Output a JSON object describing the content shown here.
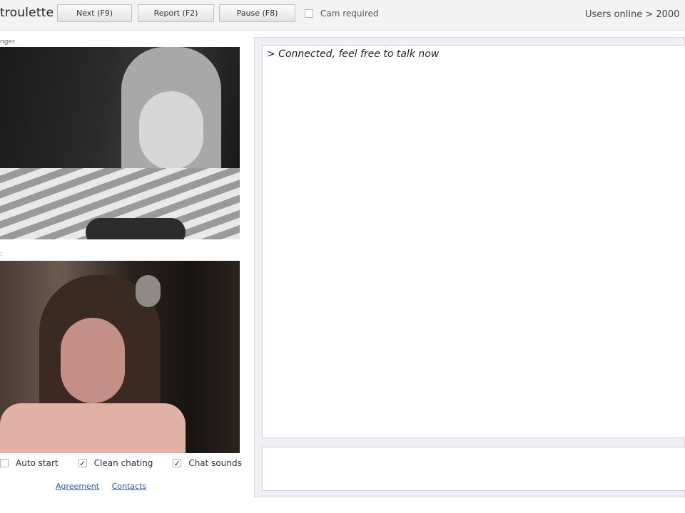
{
  "app": {
    "logo_text": "troulette",
    "users_online": "Users online > 2000"
  },
  "toolbar": {
    "next_label": "Next (F9)",
    "report_label": "Report (F2)",
    "pause_label": "Pause (F8)",
    "cam_required_label": "Cam required",
    "cam_required_checked": false
  },
  "videos": {
    "stranger_caption": "nger",
    "you_caption": ":"
  },
  "options": {
    "auto_start_label": "Auto start",
    "auto_start_checked": false,
    "clean_chatting_label": "Clean chating",
    "clean_chatting_checked": true,
    "chat_sounds_label": "Chat sounds",
    "chat_sounds_checked": true
  },
  "links": {
    "agreement_label": "Agreement",
    "contacts_label": "Contacts"
  },
  "chat": {
    "status_message": "> Connected, feel free to talk now",
    "input_value": ""
  },
  "colors": {
    "link": "#2a5db0",
    "panel_background": "#eef0f3",
    "toolbar_background": "#f3f3f3"
  }
}
